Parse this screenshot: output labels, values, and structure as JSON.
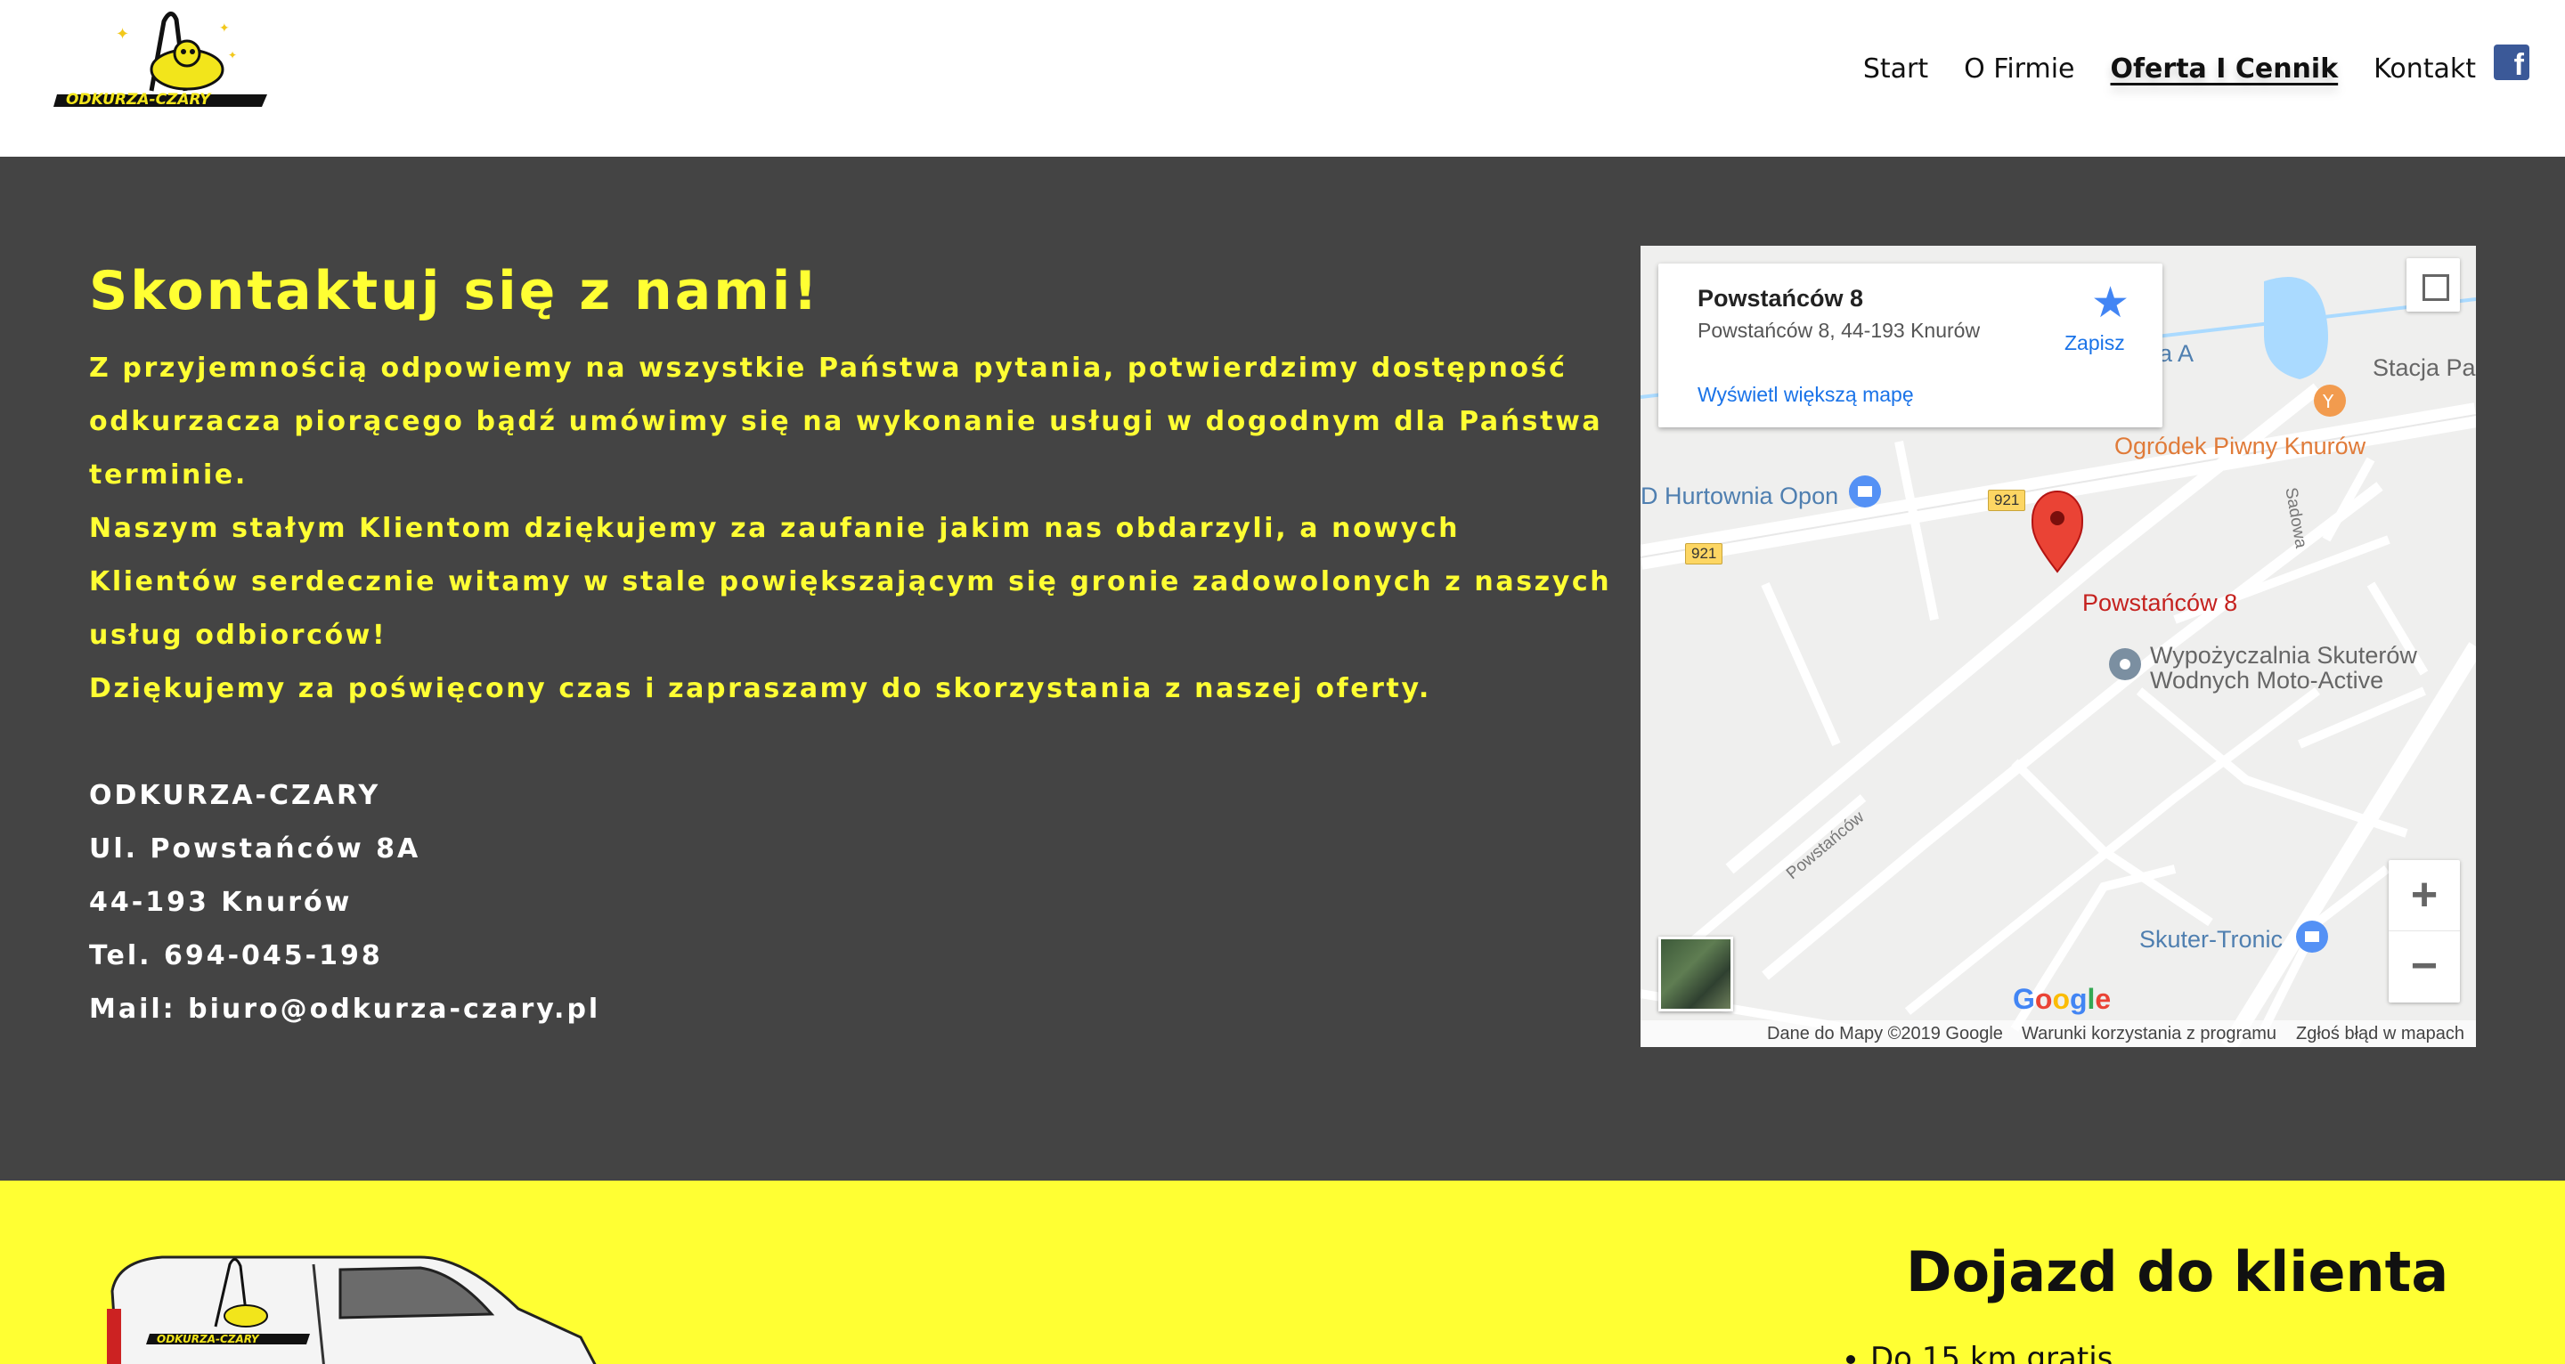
{
  "header": {
    "logo_text": "ODKURZA-CZARY",
    "nav": [
      "Start",
      "O Firmie",
      "Oferta I Cennik",
      "Kontakt"
    ],
    "active_nav": "Oferta I Cennik",
    "facebook_icon": "facebook-icon"
  },
  "contact": {
    "title": "Skontaktuj się z nami!",
    "paragraph1": "Z przyjemnością odpowiemy na wszystkie Państwa pytania, potwierdzimy dostępność odkurzacza piorącego bądź umówimy się na wykonanie usługi w dogodnym dla Państwa terminie.",
    "paragraph2": "Naszym stałym Klientom dziękujemy za zaufanie jakim nas obdarzyli, a nowych Klientów serdecznie witamy w stale powiększającym się gronie zadowolonych z naszych usług odbiorców!",
    "paragraph3": "Dziękujemy za poświęcony czas i zapraszamy do skorzystania z naszej oferty.",
    "company": "ODKURZA-CZARY",
    "street": "Ul. Powstańców 8A",
    "city": "44-193 Knurów",
    "phone": "Tel. 694-045-198",
    "mail": "Mail: biuro@odkurza-czary.pl"
  },
  "map": {
    "card_name": "Powstańców 8",
    "card_address": "Powstańców 8, 44-193 Knurów",
    "card_link": "Wyświetl większą mapę",
    "save_label": "Zapisz",
    "pin_label": "Powstańców 8",
    "poi": {
      "ogrodek": "Ogródek Piwny Knurów",
      "hurtownia": "D Hurtownia Opon",
      "wypozyczalnia_1": "Wypożyczalnia Skuterów",
      "wypozyczalnia_2": "Wodnych Moto-Active",
      "skuter": "Skuter-Tronic",
      "stacja": "Stacja Pa",
      "a_label": "a A"
    },
    "roads": {
      "road921": "921",
      "sadowa": "Sadowa",
      "powstancow": "Powstańców"
    },
    "zoom_in": "+",
    "zoom_out": "−",
    "google": {
      "g": "G",
      "o1": "o",
      "o2": "o",
      "g2": "g",
      "l": "l",
      "e": "e"
    },
    "attrib_data": "Dane do Mapy ©2019 Google",
    "attrib_terms": "Warunki korzystania z programu",
    "attrib_report": "Zgłoś błąd w mapach"
  },
  "travel": {
    "title": "Dojazd do klienta",
    "first_item": "Do 15 km gratis"
  },
  "colors": {
    "accent_yellow": "#ffff33",
    "dark_bg": "#444444",
    "map_pin": "#ea4335"
  }
}
